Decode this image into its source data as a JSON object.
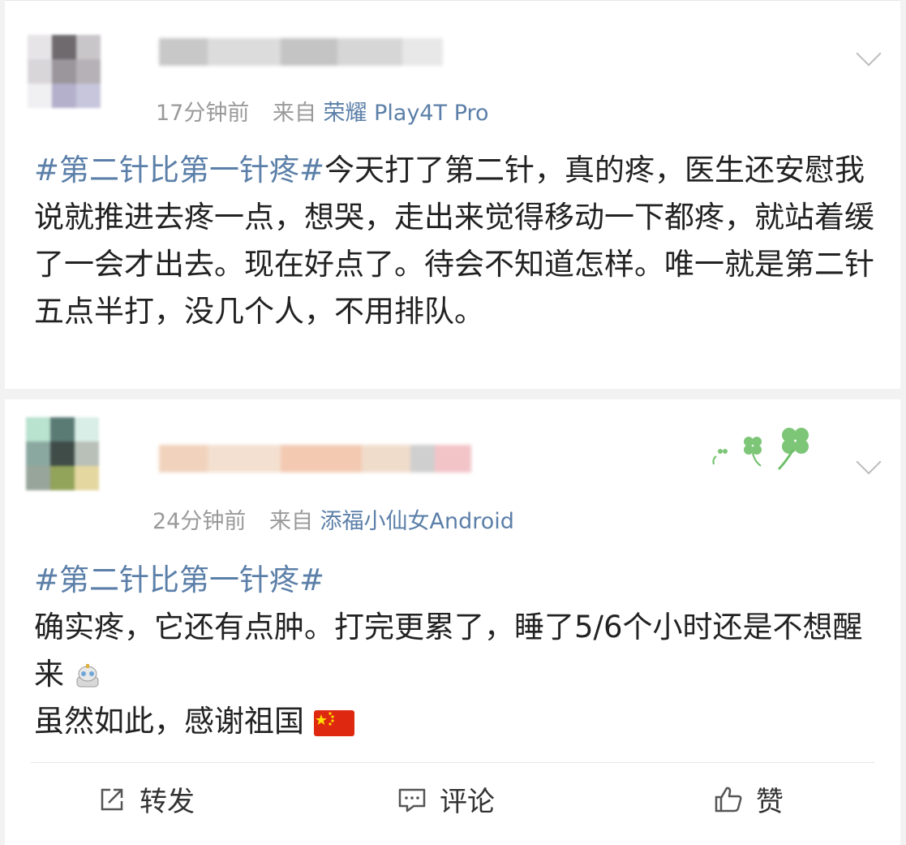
{
  "posts": [
    {
      "time": "17分钟前",
      "from_label": "来自",
      "source": "荣耀 Play4T Pro",
      "hashtag": "#第二针比第一针疼#",
      "body": "今天打了第二针，真的疼，医生还安慰我说就推进去疼一点，想哭，走出来觉得移动一下都疼，就站着缓了一会才出去。现在好点了。待会不知道怎样。唯一就是第二针五点半打，没几个人，不用排队。"
    },
    {
      "time": "24分钟前",
      "from_label": "来自",
      "source": "添福小仙女Android",
      "hashtag": "#第二针比第一针疼#",
      "body_line1": "确实疼，它还有点肿。打完更累了，睡了5/6个小时还是不想醒来",
      "body_line2": "虽然如此，感谢祖国"
    }
  ],
  "actions": {
    "repost": "转发",
    "comment": "评论",
    "like": "赞"
  },
  "colors": {
    "link": "#5b7fa8",
    "meta": "#9a9a9a",
    "text": "#222222"
  },
  "icons": {
    "menu": "chevron-down-icon",
    "repost": "share-box-icon",
    "comment": "comment-bubble-icon",
    "like": "thumbs-up-icon",
    "emoji": "robot-emoji-icon",
    "flag": "china-flag-icon",
    "decoration": "clover-icon"
  }
}
